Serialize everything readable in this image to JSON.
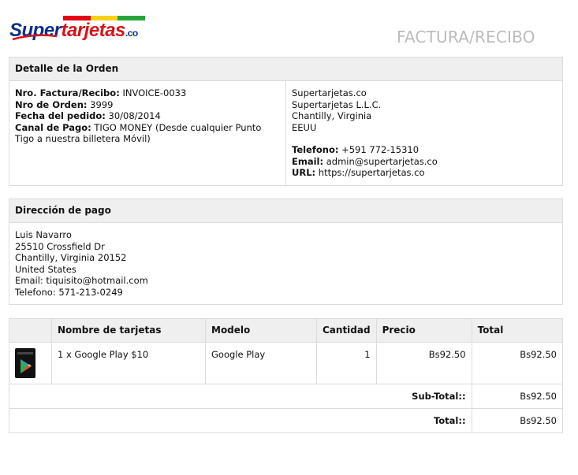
{
  "logo": {
    "part1": "Super",
    "part2": "tarjetas",
    "part3": ".co",
    "flag_colors": [
      "#e30613",
      "#f7d117",
      "#2aa33a"
    ]
  },
  "doc_title": "FACTURA/RECIBO",
  "order": {
    "header": "Detalle de la Orden",
    "invoice_label": "Nro. Factura/Recibo:",
    "invoice_value": "INVOICE-0033",
    "order_label": "Nro de Orden:",
    "order_value": "3999",
    "date_label": "Fecha del pedido:",
    "date_value": "30/08/2014",
    "channel_label": "Canal de Pago:",
    "channel_value": "TIGO MONEY (Desde cualquier Punto Tigo a nuestra billetera Móvil)"
  },
  "store": {
    "line1": "Supertarjetas.co",
    "line2": "Supertarjetas L.L.C.",
    "line3": "Chantilly, Virginia",
    "line4": "EEUU",
    "phone_label": "Telefono:",
    "phone_value": "+591 772-15310",
    "email_label": "Email:",
    "email_value": "admin@supertarjetas.co",
    "url_label": "URL:",
    "url_value": "https://supertarjetas.co"
  },
  "payment_address": {
    "header": "Dirección de pago",
    "name": "Luis Navarro",
    "street": "25510 Crossfield Dr",
    "city": "Chantilly, Virginia 20152",
    "country": "United States",
    "email": "Email: tiquisito@hotmail.com",
    "phone": "Telefono: 571-213-0249"
  },
  "items": {
    "columns": [
      "Nombre de tarjetas",
      "Modelo",
      "Cantidad",
      "Precio",
      "Total"
    ],
    "rows": [
      {
        "icon": "google-play-card-icon",
        "name": "1 x Google Play $10",
        "model": "Google Play",
        "qty": "1",
        "price": "Bs92.50",
        "total": "Bs92.50"
      }
    ],
    "subtotal_label": "Sub-Total::",
    "subtotal_value": "Bs92.50",
    "total_label": "Total::",
    "total_value": "Bs92.50"
  }
}
